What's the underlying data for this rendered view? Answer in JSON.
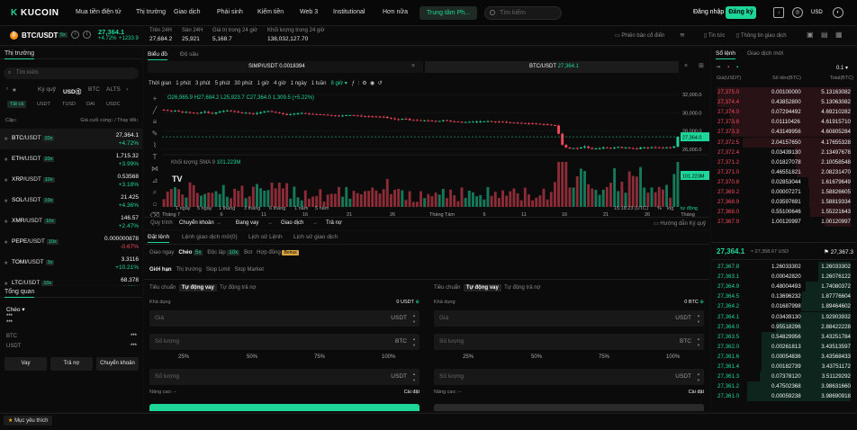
{
  "nav": {
    "brand": "KUCOIN",
    "items": [
      "Mua tiền điện tử",
      "Thị trường",
      "Giao dịch",
      "Phái sinh",
      "Kiếm tiền",
      "Web 3",
      "Institutional",
      "Hơn nữa"
    ],
    "hub": "Trung tâm Ph...",
    "search_placeholder": "Tìm kiếm",
    "login": "Đăng nhập",
    "register": "Đăng ký",
    "currency": "USD"
  },
  "ticker": {
    "pair": "BTC/USDT",
    "tag": "5x",
    "price": "27,364.1",
    "change": "+4.72%",
    "change_abs": "+1233.9",
    "stats": [
      {
        "label": "Trên 24H",
        "value": "27,684.2"
      },
      {
        "label": "Sàn 24H",
        "value": "25,921"
      },
      {
        "label": "Giá trị trong 24 giờ",
        "value": "5,168.7"
      },
      {
        "label": "Khối lượng trong 24 giờ",
        "value": "138,032,127.70"
      }
    ],
    "right": [
      "Phiên bản cổ điển",
      "Tin tức",
      "Thông tin giao dịch"
    ]
  },
  "left": {
    "title": "Thị trường",
    "search": "Tìm kiếm",
    "tabs": [
      "Ký quỹ",
      "USDⓈ",
      "BTC",
      "ALTS"
    ],
    "filters": [
      "Tất cả",
      "USDT",
      "TUSD",
      "DAI",
      "USDC"
    ],
    "col_pair": "Cặp↕",
    "col_price": "Giá cuối cùng↕ / Thay đổi↕",
    "rows": [
      {
        "base": "BTC",
        "quote": "/USDT",
        "lev": "10x",
        "price": "27,364.1",
        "change": "+4.72%",
        "up": true,
        "active": true
      },
      {
        "base": "ETH",
        "quote": "/USDT",
        "lev": "10x",
        "price": "1,715.32",
        "change": "+3.99%",
        "up": true
      },
      {
        "base": "XRP",
        "quote": "/USDT",
        "lev": "10x",
        "price": "0.53568",
        "change": "+3.18%",
        "up": true
      },
      {
        "base": "SOL",
        "quote": "/USDT",
        "lev": "10x",
        "price": "21.425",
        "change": "+4.36%",
        "up": true
      },
      {
        "base": "XMR",
        "quote": "/USDT",
        "lev": "10x",
        "price": "146.57",
        "change": "+2.47%",
        "up": true
      },
      {
        "base": "PEPE",
        "quote": "/USDT",
        "lev": "10x",
        "price": "0.000000878",
        "change": "-0.67%",
        "up": false
      },
      {
        "base": "TOMI",
        "quote": "/USDT",
        "lev": "3x",
        "price": "3.3116",
        "change": "+10.21%",
        "up": true
      },
      {
        "base": "LTC",
        "quote": "/USDT",
        "lev": "10x",
        "price": "68.378",
        "change": "+4.89%",
        "up": true
      }
    ],
    "overview_title": "Tổng quan",
    "overview_mode": "Chéo",
    "ov_stars": "***",
    "ov_btc": "BTC",
    "ov_usdt": "USDT",
    "ov_val": "***",
    "buttons": [
      "Vay",
      "Trả nợ",
      "Chuyển khoản"
    ],
    "favorites": "Mục yêu thích"
  },
  "chart": {
    "tabs": [
      "Biểu đồ",
      "Độ sâu"
    ],
    "inst_tabs": [
      "SIMP/USDT",
      "0.0018394",
      "BTC/USDT",
      "27,364.1"
    ],
    "intervals": [
      "Thời gian",
      "1 phút",
      "3 phút",
      "5 phút",
      "30 phút",
      "1 giờ",
      "4 giờ",
      "1 ngày",
      "1 tuần",
      "8 giờ ▾"
    ],
    "ohlc": {
      "o": "O26,965.9",
      "h": "H27,684.2",
      "l": "L25,923.7",
      "c": "C27,364.0",
      "ch": "1,309.5 (+5.22%)"
    },
    "y_ticks": [
      "32,000.0",
      "30,000.0",
      "28,000.0",
      "26,000.0"
    ],
    "last_price_tag": "27,364.0",
    "vol_label": "Khối lượng SMA 9",
    "vol_value": "101.223M",
    "vol_tag": "101.223M",
    "x_ticks": [
      "Tháng 7",
      "6",
      "11",
      "16",
      "21",
      "26",
      "Tháng Tám",
      "6",
      "11",
      "16",
      "21",
      "26",
      "Tháng"
    ],
    "ranges": [
      "1 ngày",
      "5 ngày",
      "1 tháng",
      "3 tháng",
      "6 tháng",
      "1 năm",
      "5 năm"
    ],
    "time": "15:18:23 (UTC)",
    "pct": "%",
    "log": "log",
    "auto": "tự động",
    "closes": [
      30300,
      30250,
      30180,
      30230,
      30140,
      30050,
      30090,
      30010,
      29970,
      29950,
      30020,
      30100,
      29980,
      29910,
      30030,
      30110,
      30200,
      30240,
      30180,
      30120,
      30040,
      29980,
      29990,
      29920,
      29880,
      29960,
      30050,
      30150,
      30180,
      30100,
      30020,
      29950,
      29870,
      29760,
      29820,
      29900,
      29930,
      29960,
      29900,
      29870,
      29840,
      29820,
      29800,
      29780,
      29750,
      29710,
      29680,
      29660,
      29690,
      29720,
      29740,
      29700,
      29680,
      29650,
      29630,
      29610,
      29590,
      29570,
      29560,
      29550,
      29420,
      29380,
      29300,
      29260,
      29340,
      29330,
      29200,
      29190,
      29180,
      29160,
      29160,
      29120,
      29100,
      29080,
      29090,
      29180,
      29120,
      29050,
      29030,
      29010,
      28980,
      28990,
      29000,
      29010,
      29020,
      29040,
      29060,
      29070,
      29040,
      29020,
      29010,
      28990,
      28960,
      28920,
      28900,
      28880,
      28860,
      28850,
      28830,
      28810,
      28790,
      28760,
      28740,
      28700,
      28650,
      28600,
      27700,
      26500,
      26200,
      26100,
      26120,
      26100,
      26200,
      26300,
      26150,
      26050,
      26080,
      26100,
      26200,
      26150,
      26100,
      26180,
      26250,
      26150,
      26200,
      26120,
      26100,
      26050,
      26180,
      26200,
      26150,
      26220,
      26190,
      26170,
      26160,
      26200,
      26180,
      26300,
      27364
    ],
    "legend": "Quy trình",
    "subtabs": [
      "Chuyển khoản",
      "Đang vay",
      "Giao dịch",
      "Trả nợ"
    ],
    "guide": "Hướng dẫn Ký quỹ"
  },
  "orderbook": {
    "tabs": [
      "Sổ lệnh",
      "Giao dịch mới"
    ],
    "precision": "0.1 ▾",
    "headers": [
      "Giá(USDT)",
      "Số tiền(BTC)",
      "Total(BTC)"
    ],
    "asks": [
      [
        "27,375.0",
        "0.00100000",
        "5.13163082"
      ],
      [
        "27,374.4",
        "0.43852800",
        "5.13063082"
      ],
      [
        "27,374.0",
        "0.07294492",
        "4.69210282"
      ],
      [
        "27,373.8",
        "0.01110426",
        "4.61915710"
      ],
      [
        "27,373.3",
        "0.43149956",
        "4.60805284"
      ],
      [
        "27,372.5",
        "2.04157650",
        "4.17655328"
      ],
      [
        "27,372.4",
        "0.03439130",
        "2.13497678"
      ],
      [
        "27,371.2",
        "0.01827078",
        "2.10058548"
      ],
      [
        "27,371.0",
        "0.46551821",
        "2.08231470"
      ],
      [
        "27,370.8",
        "0.02853044",
        "1.61679649"
      ],
      [
        "27,369.2",
        "0.00007271",
        "1.58826605"
      ],
      [
        "27,368.9",
        "0.03597691",
        "1.58819334"
      ],
      [
        "27,368.0",
        "0.55100646",
        "1.55221643"
      ],
      [
        "27,367.9",
        "1.00120997",
        "1.00120997"
      ]
    ],
    "mid_price": "27,364.1",
    "mid_usd": "≈ 27,358.67 USD",
    "mid_right": "27,367.3",
    "bids": [
      [
        "27,367.8",
        "1.26033302",
        "1.26033302"
      ],
      [
        "27,363.1",
        "0.00042820",
        "1.26076122"
      ],
      [
        "27,364.9",
        "0.48004493",
        "1.74080372"
      ],
      [
        "27,364.5",
        "0.13696232",
        "1.87776604"
      ],
      [
        "27,364.2",
        "0.01687998",
        "1.89464602"
      ],
      [
        "27,364.1",
        "0.03439130",
        "1.92903932"
      ],
      [
        "27,364.0",
        "0.95518296",
        "2.88422228"
      ],
      [
        "27,363.5",
        "0.54829956",
        "3.43251784"
      ],
      [
        "27,362.0",
        "0.00261813",
        "3.43513597"
      ],
      [
        "27,361.6",
        "0.00054836",
        "3.43568433"
      ],
      [
        "27,361.4",
        "0.00182739",
        "3.43751172"
      ],
      [
        "27,361.3",
        "0.07378120",
        "3.51129292"
      ],
      [
        "27,361.2",
        "0.47502368",
        "3.98631660"
      ],
      [
        "27,361.0",
        "0.00059238",
        "3.98690918"
      ]
    ]
  },
  "trade": {
    "tabs": [
      "Đặt lệnh",
      "Lệnh giao dịch mở(0)",
      "Lịch sử Lệnh",
      "Lịch sử giao dịch"
    ],
    "modes": [
      "Giao ngay",
      "Chéo",
      "5x",
      "Độc lập",
      "10x",
      "Bot",
      "Hợp đồng",
      "Bonus"
    ],
    "types": [
      "Giới hạn",
      "Thị trường",
      "Stop Limit",
      "Stop Market"
    ],
    "buy": {
      "subtabs": [
        "Tiêu chuẩn",
        "Tự động vay",
        "Tự động trả nợ"
      ],
      "avail_label": "Khả dụng",
      "avail": "0 USDT",
      "price": "Giá",
      "price_unit": "USDT",
      "amount": "Số lượng",
      "amount_unit": "BTC",
      "pcts": [
        "25%",
        "50%",
        "75%",
        "100%"
      ],
      "total": "Số lượng",
      "total_unit": "USDT",
      "adv": "Nâng cao: --",
      "settings": "Cài đặt"
    },
    "sell": {
      "subtabs": [
        "Tiêu chuẩn",
        "Tự động vay",
        "Tự động trả nợ"
      ],
      "avail_label": "Khả dụng",
      "avail": "0 BTC",
      "price": "Giá",
      "price_unit": "USDT",
      "amount": "Số lượng",
      "amount_unit": "BTC",
      "pcts": [
        "25%",
        "50%",
        "75%",
        "100%"
      ],
      "total": "Số lượng",
      "total_unit": "USDT",
      "adv": "Nâng cao: --",
      "settings": "Cài đặt"
    }
  },
  "colors": {
    "up": "#1fd69a",
    "down": "#f5485d",
    "bg": "#0b0b0b"
  }
}
